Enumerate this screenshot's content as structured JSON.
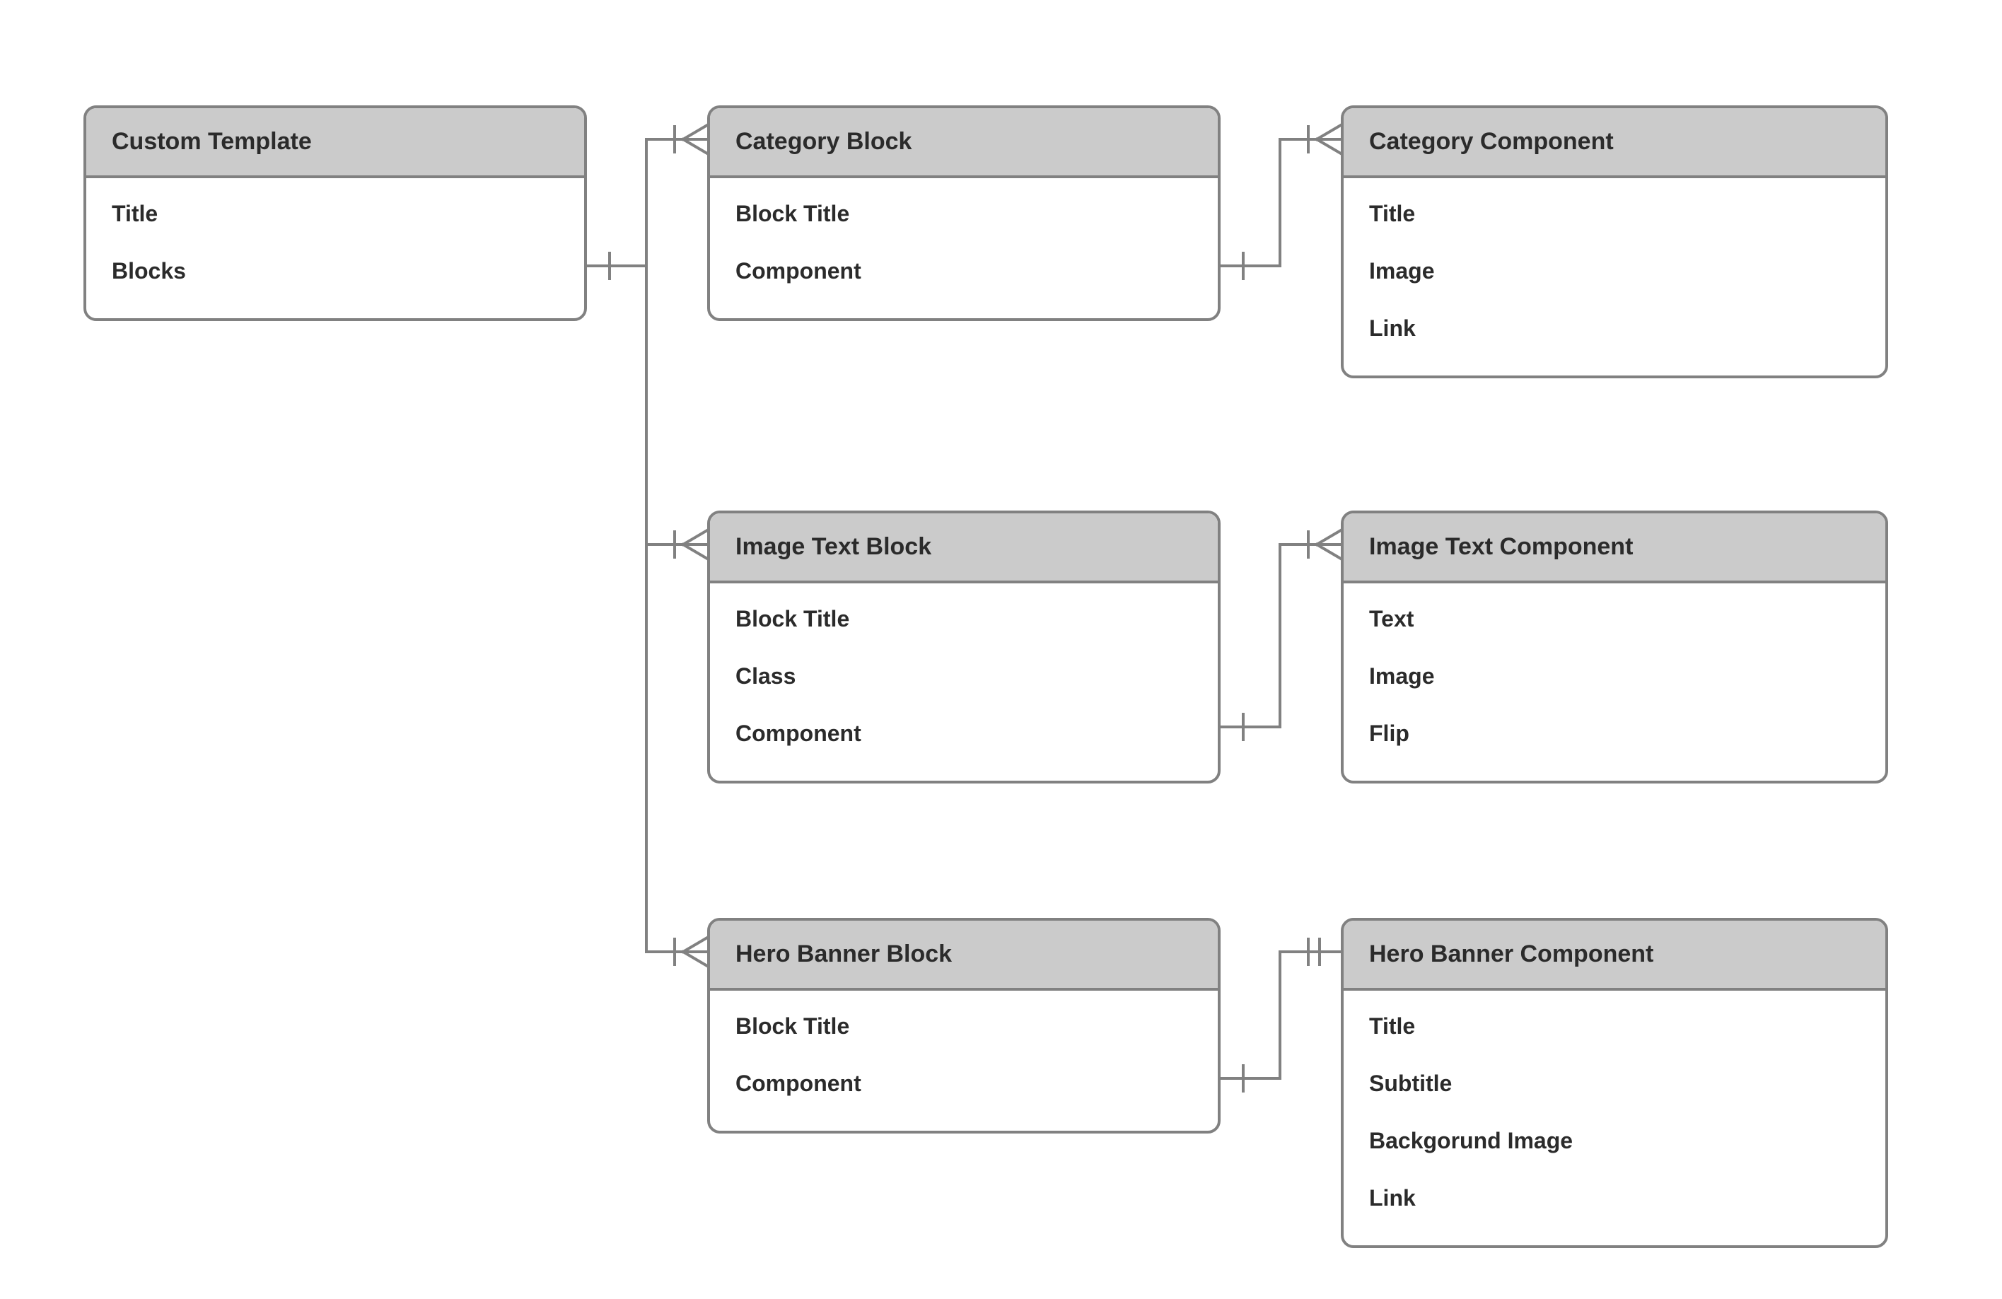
{
  "entities": {
    "custom_template": {
      "title": "Custom Template",
      "attrs": [
        "Title",
        "Blocks"
      ]
    },
    "category_block": {
      "title": "Category Block",
      "attrs": [
        "Block Title",
        "Component"
      ]
    },
    "category_component": {
      "title": "Category Component",
      "attrs": [
        "Title",
        "Image",
        "Link"
      ]
    },
    "image_text_block": {
      "title": "Image Text Block",
      "attrs": [
        "Block Title",
        "Class",
        "Component"
      ]
    },
    "image_text_component": {
      "title": "Image Text Component",
      "attrs": [
        "Text",
        "Image",
        "Flip"
      ]
    },
    "hero_banner_block": {
      "title": "Hero Banner Block",
      "attrs": [
        "Block Title",
        "Component"
      ]
    },
    "hero_banner_component": {
      "title": "Hero Banner Component",
      "attrs": [
        "Title",
        "Subtitle",
        "Backgorund Image",
        "Link"
      ]
    }
  }
}
